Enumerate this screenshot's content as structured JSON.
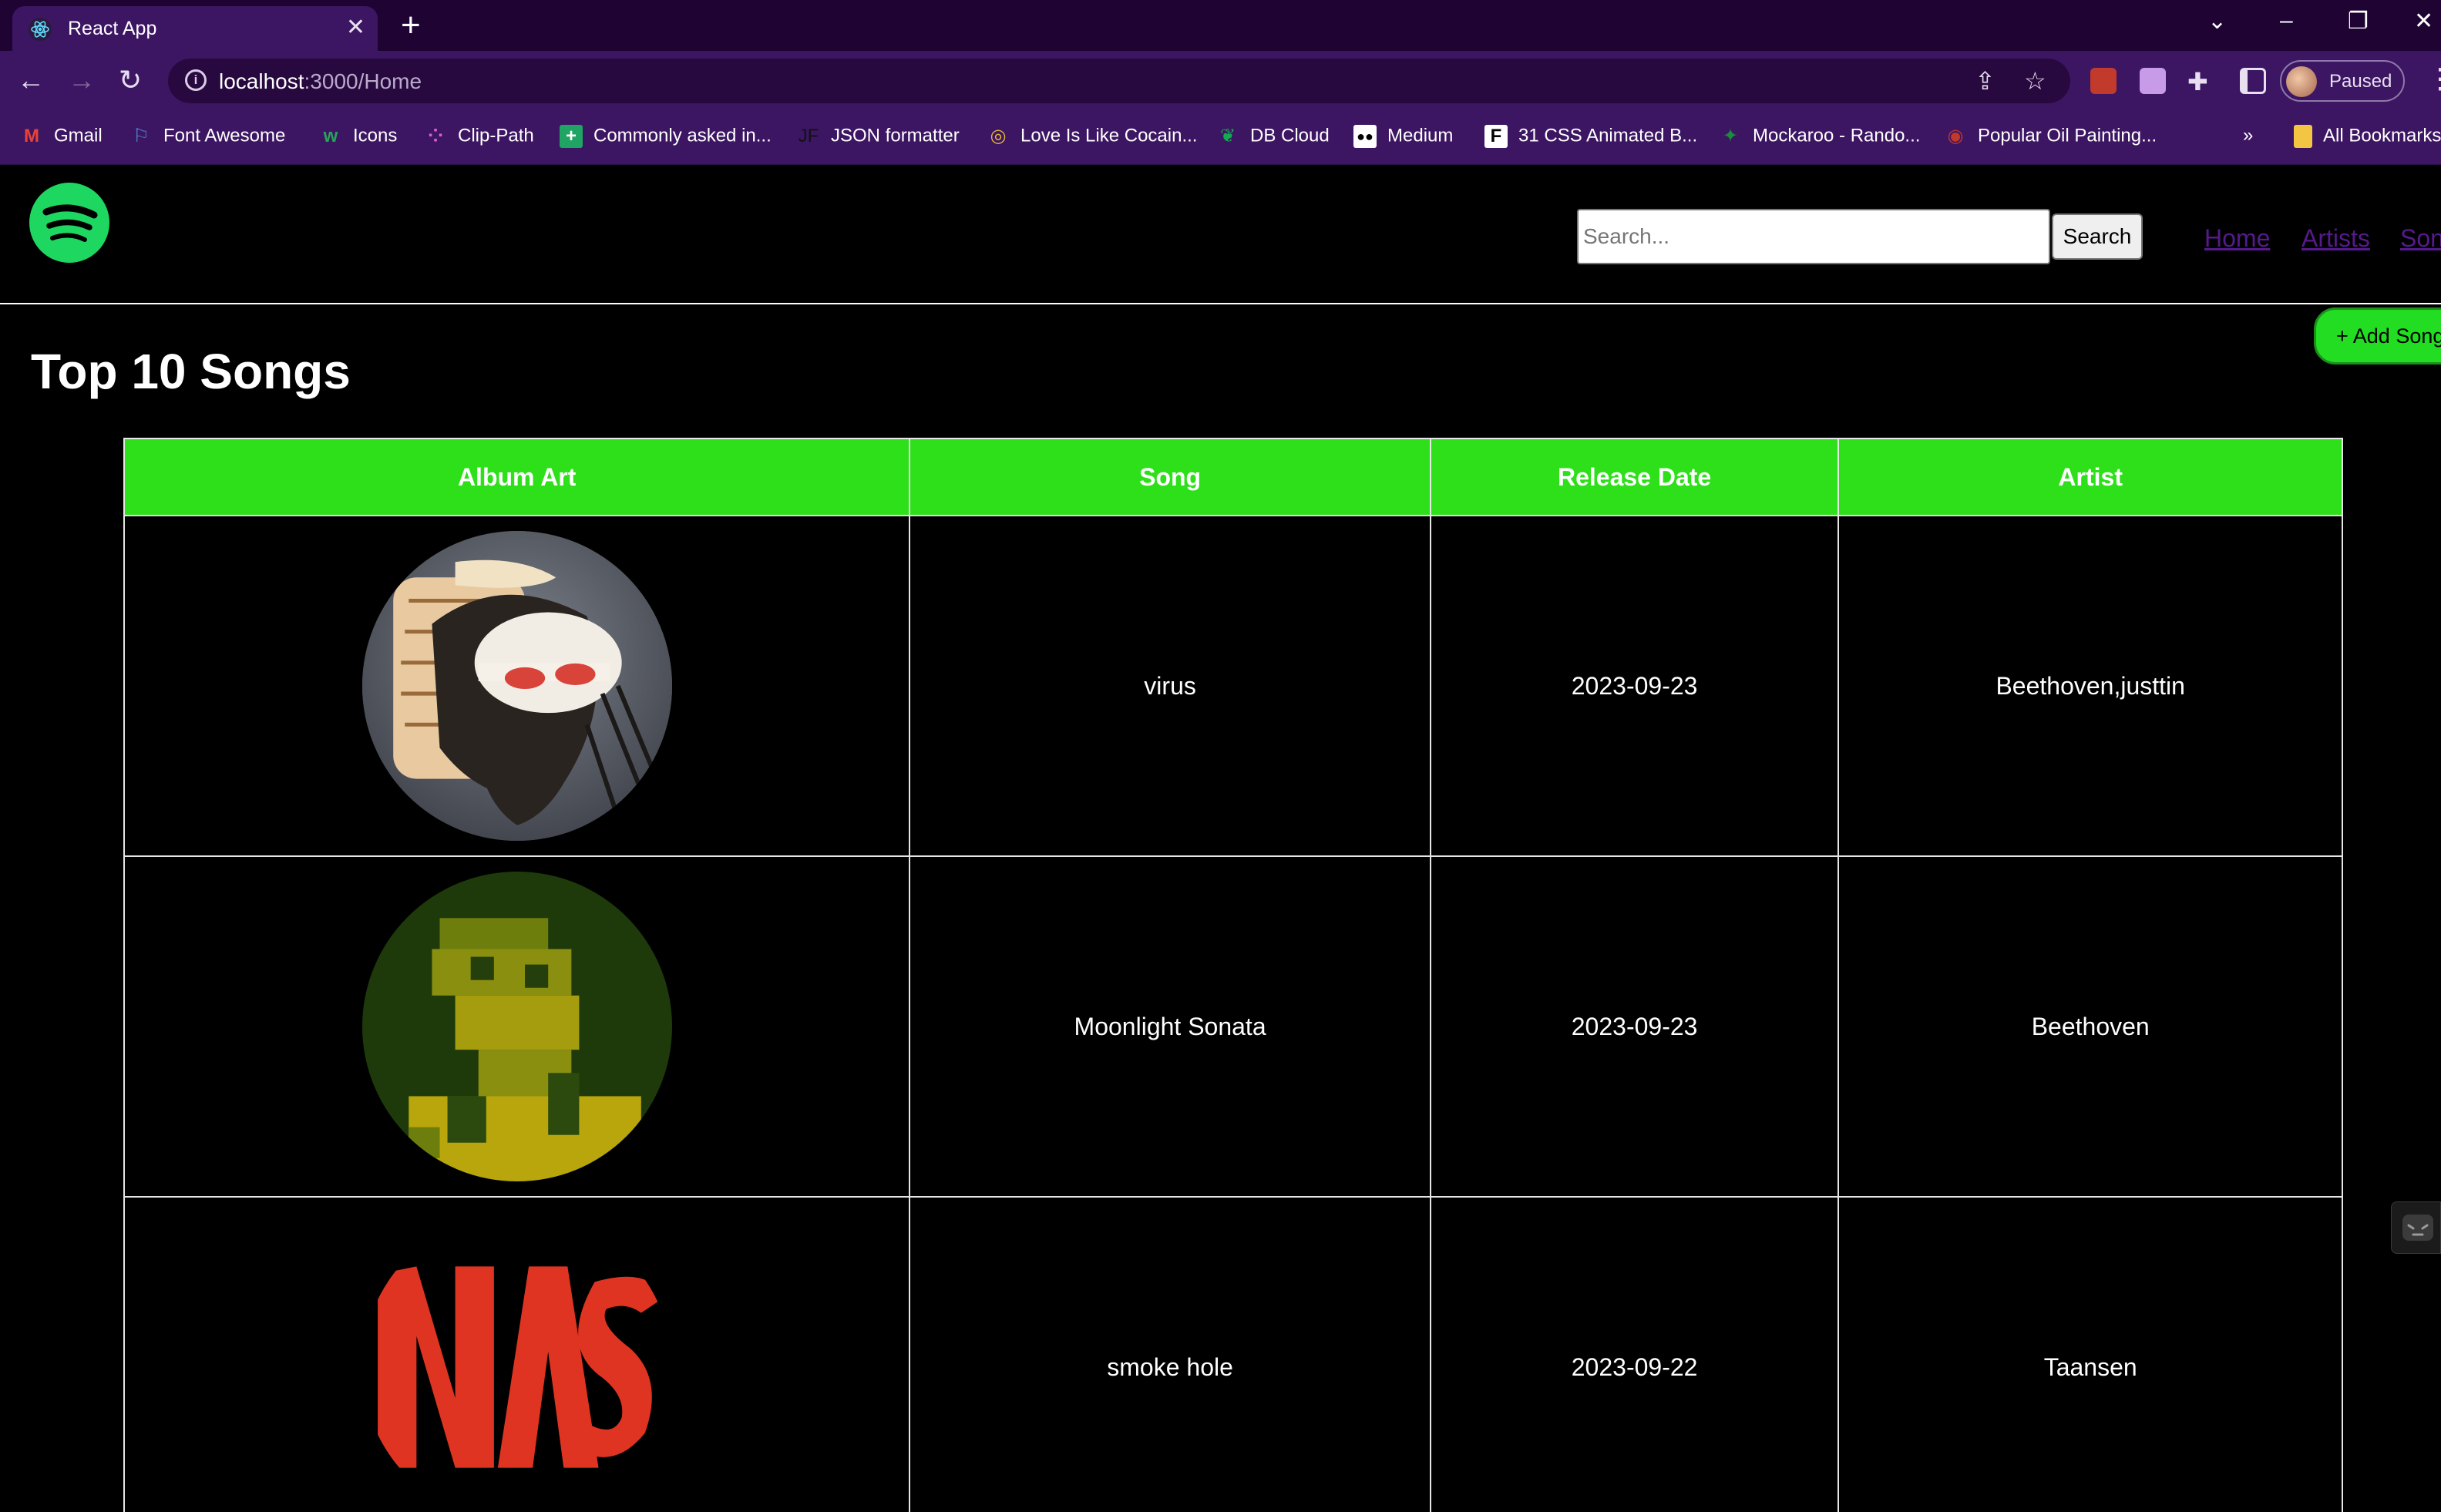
{
  "browser": {
    "tab_title": "React App",
    "url_host": "localhost",
    "url_path": ":3000/Home",
    "profile_label": "Paused",
    "bookmarks": [
      {
        "label": "Gmail",
        "icon": "gmail-icon"
      },
      {
        "label": "Font Awesome",
        "icon": "flag-icon"
      },
      {
        "label": "Icons",
        "icon": "w-icon"
      },
      {
        "label": "Clip-Path",
        "icon": "dots-icon"
      },
      {
        "label": "Commonly asked in...",
        "icon": "sheets-icon"
      },
      {
        "label": "JSON formatter",
        "icon": "jf-icon"
      },
      {
        "label": "Love Is Like Cocain...",
        "icon": "vinyl-icon"
      },
      {
        "label": "DB Cloud",
        "icon": "mongodb-leaf-icon"
      },
      {
        "label": "Medium",
        "icon": "medium-icon"
      },
      {
        "label": "31 CSS Animated B...",
        "icon": "f-icon"
      },
      {
        "label": "Mockaroo - Rando...",
        "icon": "leaf-icon"
      },
      {
        "label": "Popular Oil Painting...",
        "icon": "brush-icon"
      }
    ],
    "bookmarks_more": "»",
    "all_bookmarks": "All Bookmarks"
  },
  "navbar": {
    "search_placeholder": "Search...",
    "search_button": "Search",
    "links": [
      "Home",
      "Artists",
      "Son"
    ]
  },
  "add_song_button": "+ Add Song",
  "heading": "Top 10 Songs",
  "table": {
    "columns": [
      "Album Art",
      "Song",
      "Release Date",
      "Artist"
    ],
    "rows": [
      {
        "song": "virus",
        "release_date": "2023-09-23",
        "artist": "Beethoven,justtin",
        "art": "ukiyo-e-ghost-art"
      },
      {
        "song": "Moonlight Sonata",
        "release_date": "2023-09-23",
        "artist": "Beethoven",
        "art": "pixelated-portrait-art"
      },
      {
        "song": "smoke hole",
        "release_date": "2023-09-22",
        "artist": "Taansen",
        "art": "nasa-logo-art"
      }
    ]
  },
  "colors": {
    "header_green": "#2ee01a",
    "button_green": "#22dd22",
    "spotify_green": "#1ed760",
    "nav_link": "#551a8b",
    "chrome_purple": "#3c1663"
  }
}
